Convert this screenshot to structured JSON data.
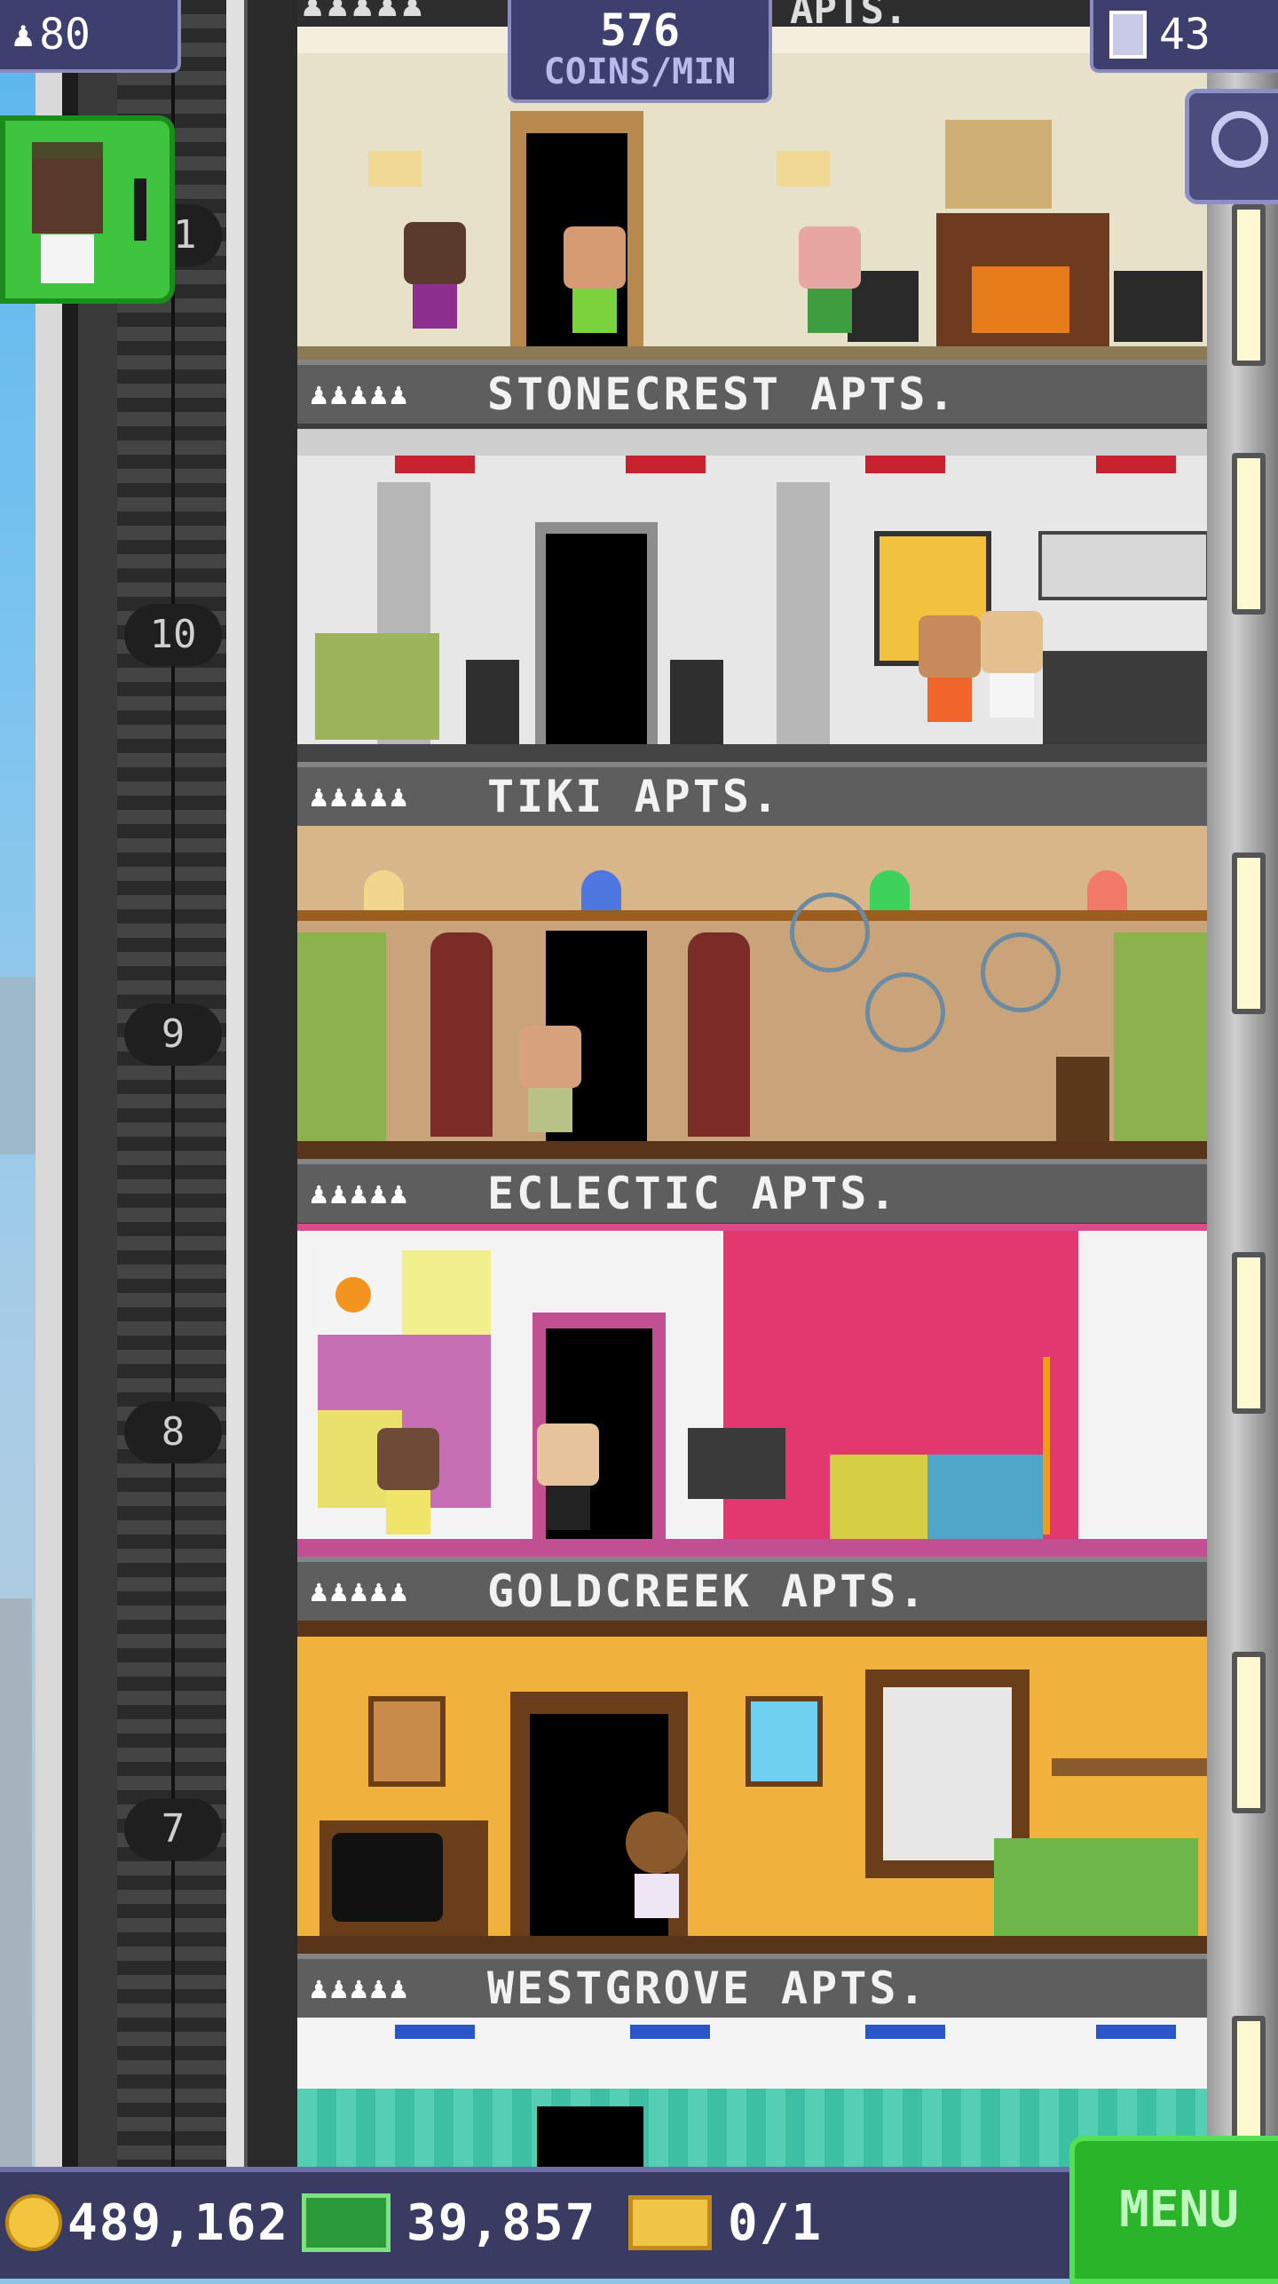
{
  "hud": {
    "population": "80",
    "coins_per_min_value": "576",
    "coins_per_min_label": "COINS/MIN",
    "top_floor_partial_label": "APTS.",
    "floor_count": "43"
  },
  "floors": [
    {
      "number": "11",
      "name": "STONECREST APTS.",
      "stars": "♟♟♟♟♟",
      "wall": "#e8e1c9"
    },
    {
      "number": "10",
      "name": "TIKI APTS.",
      "stars": "♟♟♟♟♟",
      "wall": "#e7e7e7"
    },
    {
      "number": "9",
      "name": "ECLECTIC APTS.",
      "stars": "♟♟♟♟♟",
      "wall": "#c9a37a"
    },
    {
      "number": "8",
      "name": "GOLDCREEK APTS.",
      "stars": "♟♟♟♟♟",
      "wall": "#f3f3f3"
    },
    {
      "number": "7",
      "name": "WESTGROVE APTS.",
      "stars": "♟♟♟♟♟",
      "wall": "#f0b23c"
    }
  ],
  "bottom_bar": {
    "coins": "489,162",
    "bux": "39,857",
    "tickets": "0/1",
    "menu_label": "MENU"
  },
  "icons": {
    "population": "person-icon",
    "floors": "building-icon",
    "zoom": "magnify-icon",
    "coins": "coin-icon",
    "bux": "bux-icon",
    "tickets": "ticket-icon"
  },
  "colors": {
    "hud_bg": "#3d3f6e",
    "menu_green": "#2ab42a",
    "coin_gold": "#f3c43d"
  }
}
